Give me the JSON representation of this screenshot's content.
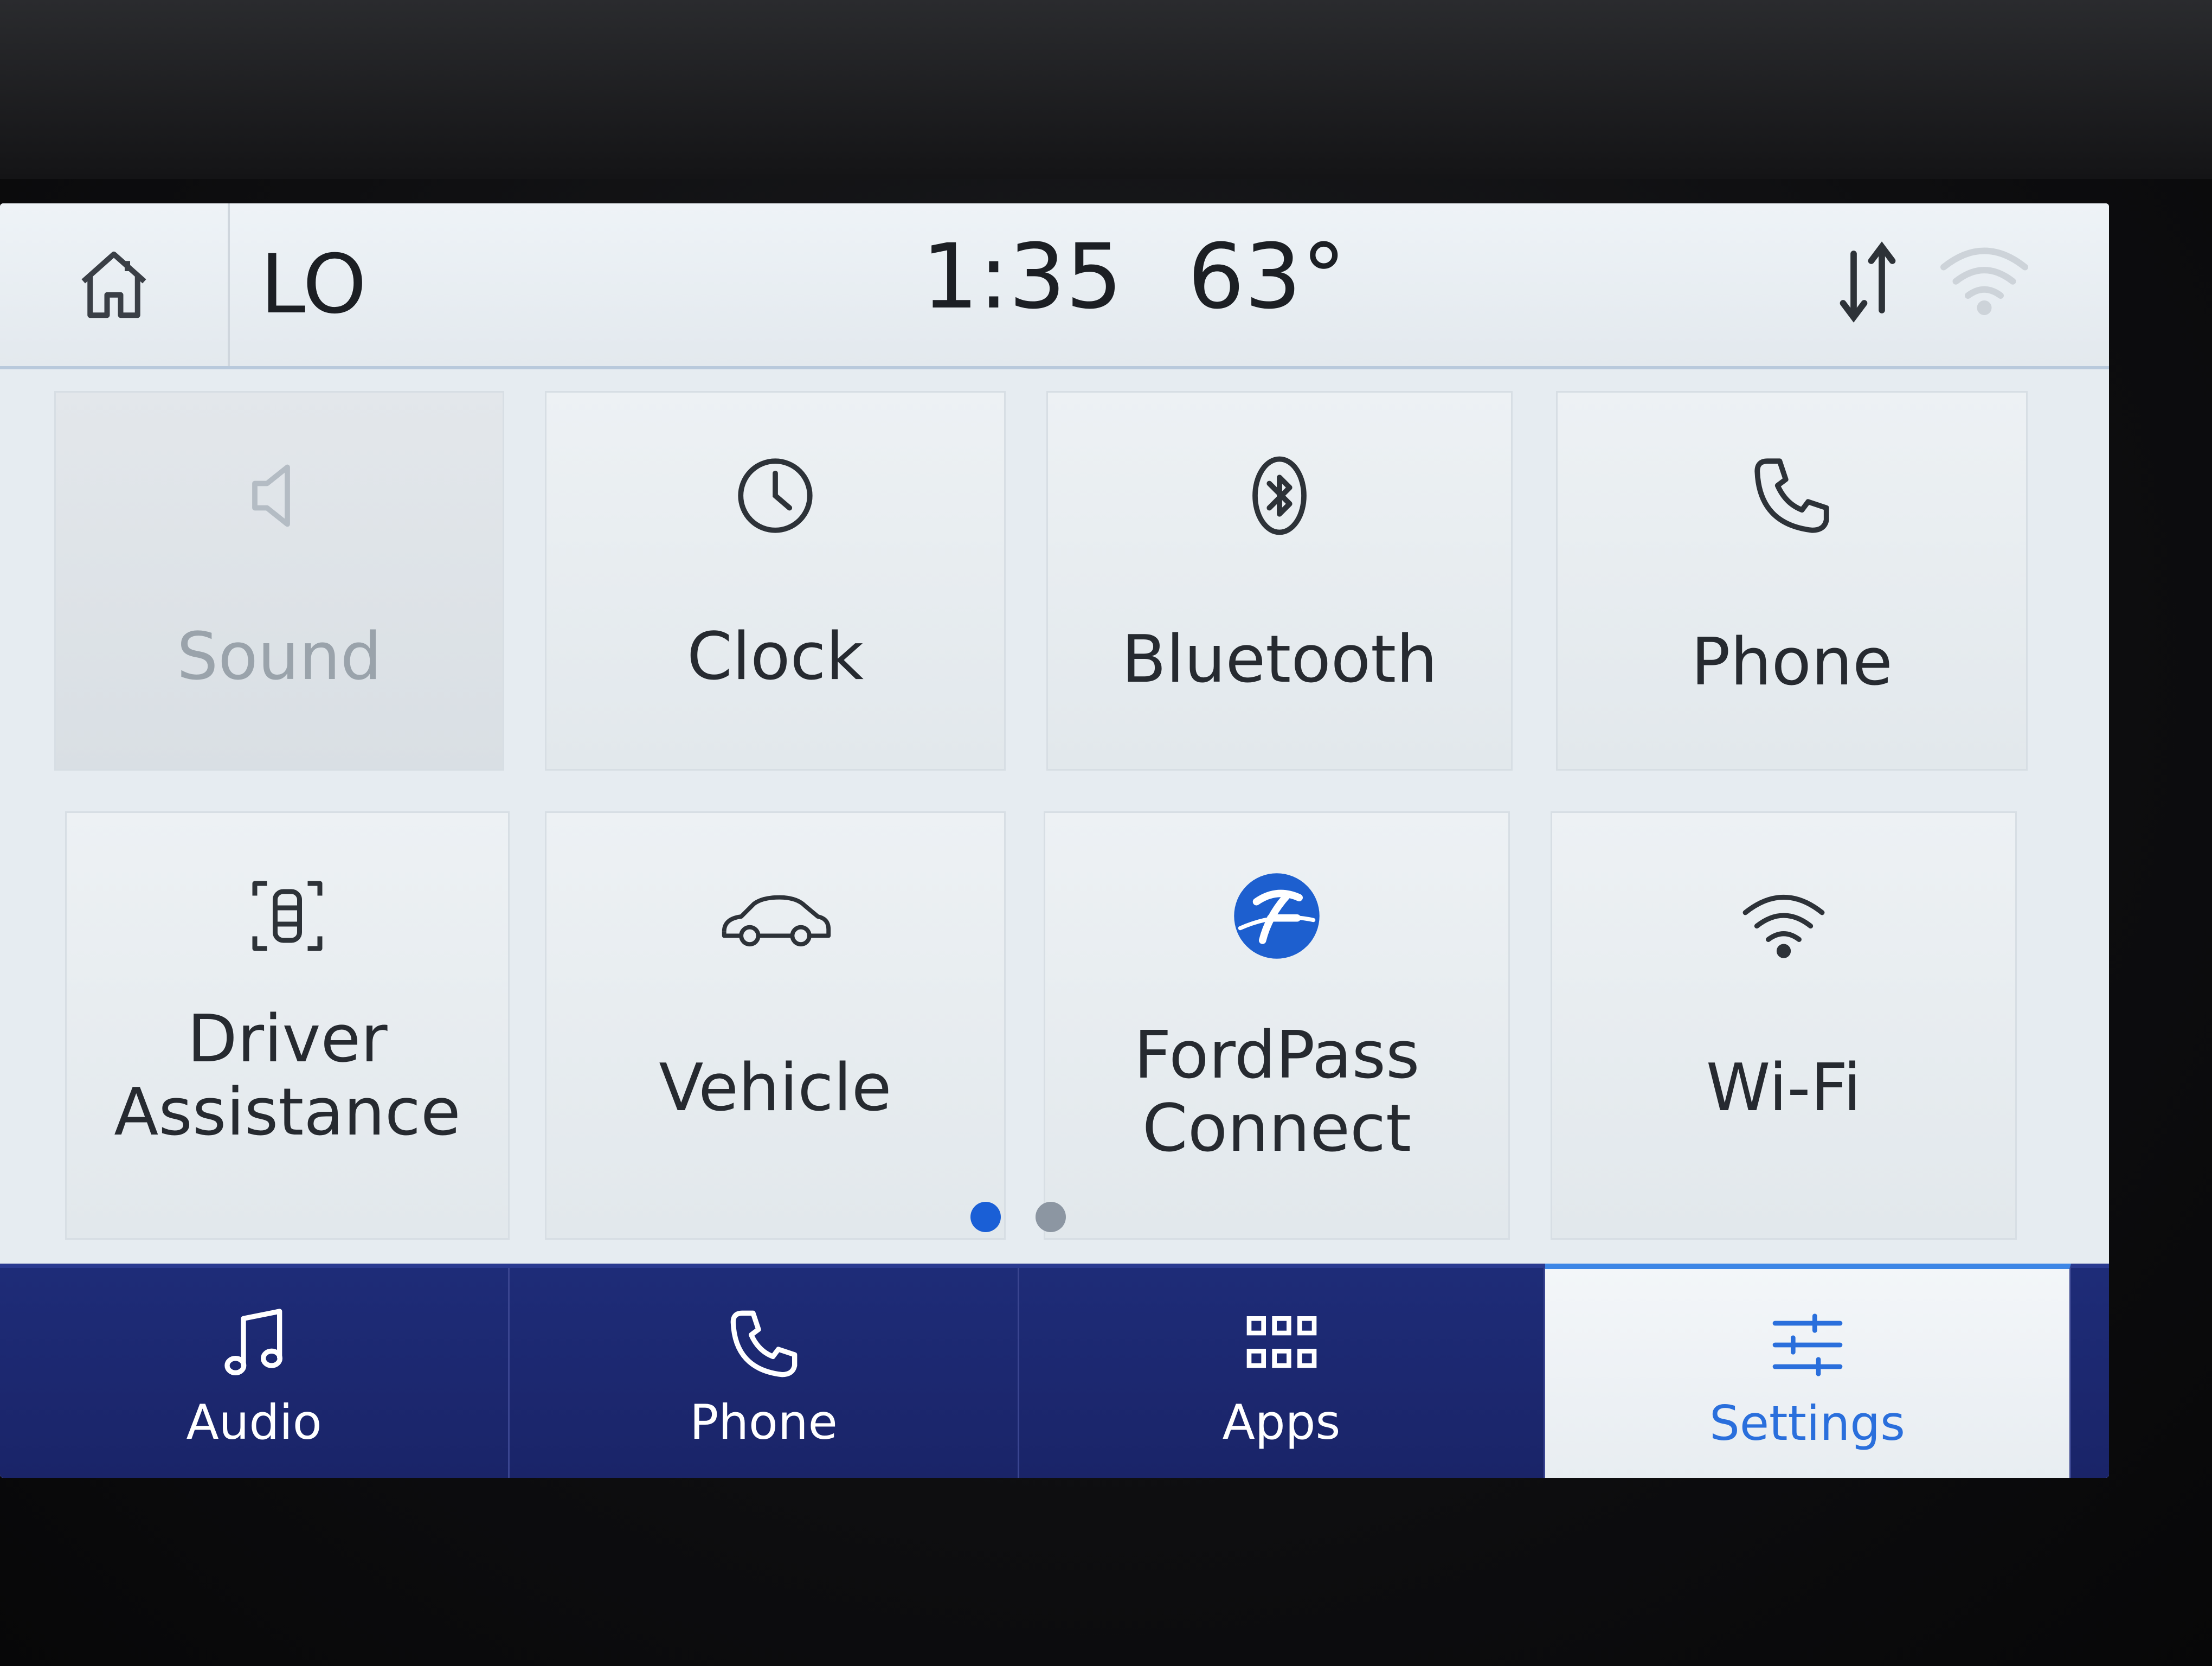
{
  "status_bar": {
    "climate": "LO",
    "time": "1:35",
    "temperature": "63°",
    "icons": [
      "home-icon",
      "data-sync-icon",
      "wifi-signal-icon"
    ]
  },
  "tiles": [
    {
      "label": "Sound",
      "icon": "speaker-icon",
      "enabled": false
    },
    {
      "label": "Clock",
      "icon": "clock-icon",
      "enabled": true
    },
    {
      "label": "Bluetooth",
      "icon": "bluetooth-icon",
      "enabled": true
    },
    {
      "label": "Phone",
      "icon": "phone-icon",
      "enabled": true
    },
    {
      "label_line1": "Driver",
      "label_line2": "Assistance",
      "icon": "driver-assist-icon",
      "enabled": true
    },
    {
      "label": "Vehicle",
      "icon": "car-icon",
      "enabled": true
    },
    {
      "label_line1": "FordPass",
      "label_line2": "Connect",
      "icon": "fordpass-logo-icon",
      "enabled": true
    },
    {
      "label": "Wi-Fi",
      "icon": "wifi-icon",
      "enabled": true
    }
  ],
  "pager": {
    "pages": 2,
    "current": 1
  },
  "bottom_nav": [
    {
      "label": "Audio",
      "icon": "music-note-icon",
      "active": false
    },
    {
      "label": "Phone",
      "icon": "phone-icon",
      "active": false
    },
    {
      "label": "Apps",
      "icon": "apps-grid-icon",
      "active": false
    },
    {
      "label": "Settings",
      "icon": "sliders-icon",
      "active": true
    }
  ],
  "colors": {
    "nav_background": "#1e2c78",
    "active_accent": "#2a6fdc",
    "pager_active": "#1a5fd6",
    "fordpass_blue": "#1d5fcf"
  }
}
